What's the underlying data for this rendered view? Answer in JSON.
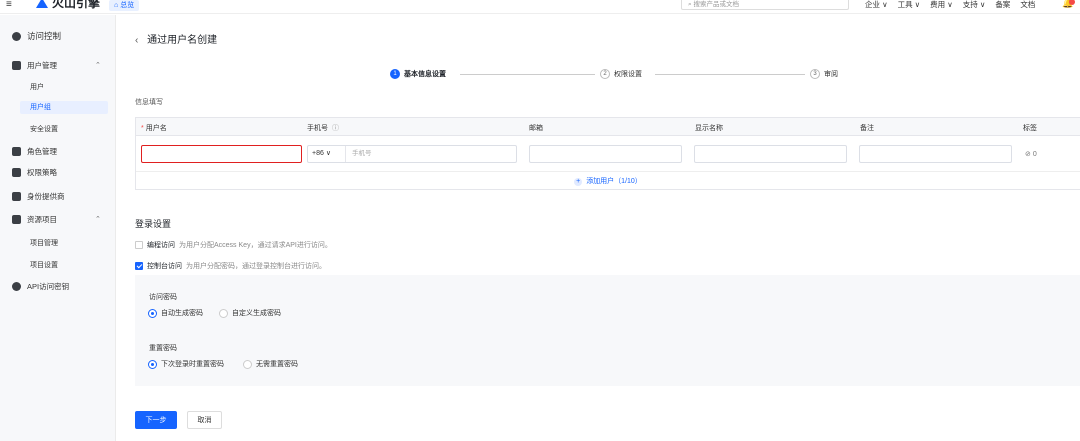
{
  "topbar": {
    "menu_icon": "≡",
    "brand": "火山引擎",
    "overview": "总览",
    "search_placeholder": "搜索产品或文档",
    "links": [
      "企业 ∨",
      "工具 ∨",
      "费用 ∨",
      "支持 ∨",
      "备案",
      "文档"
    ]
  },
  "sidebar": {
    "access_control": "访问控制",
    "user_mgmt": "用户管理",
    "user": "用户",
    "user_group": "用户组",
    "security": "安全设置",
    "role_mgmt": "角色管理",
    "policy": "权限策略",
    "idp": "身份提供商",
    "resource_proj": "资源项目",
    "proj_mgmt": "项目管理",
    "proj_settings": "项目设置",
    "api_keys": "API访问密钥"
  },
  "header": {
    "back": "‹",
    "title": "通过用户名创建"
  },
  "steps": [
    {
      "num": "1",
      "label": "基本信息设置"
    },
    {
      "num": "2",
      "label": "权限设置"
    },
    {
      "num": "3",
      "label": "审阅"
    }
  ],
  "form": {
    "section": "信息填写",
    "columns": {
      "username": "用户名",
      "phone": "手机号",
      "email": "邮箱",
      "display_name": "显示名称",
      "note": "备注",
      "tags": "标签"
    },
    "phone_prefix": "+86 ∨",
    "phone_placeholder": "手机号",
    "tag_count": "0",
    "add_user": "添加用户（1/10）"
  },
  "login": {
    "title": "登录设置",
    "prog_name": "编程访问",
    "prog_desc": "为用户分配Access Key，通过请求API进行访问。",
    "console_name": "控制台访问",
    "console_desc": "为用户分配密码，通过登录控制台进行访问。",
    "access_pw": "访问密码",
    "auto_pw": "自动生成密码",
    "custom_pw": "自定义生成密码",
    "reset_pw": "重置密码",
    "reset_next": "下次登录时重置密码",
    "no_reset": "无需重置密码"
  },
  "actions": {
    "next": "下一步",
    "cancel": "取消"
  }
}
